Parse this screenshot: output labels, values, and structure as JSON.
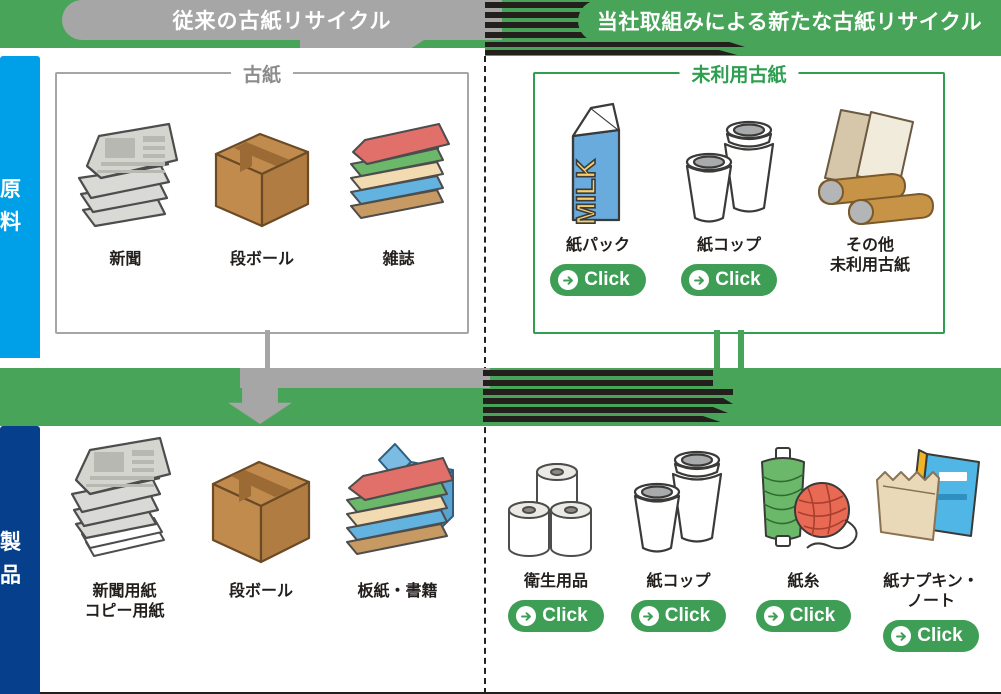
{
  "header": {
    "left_banner": "従来の古紙リサイクル",
    "right_banner": "当社取組みによる新たな古紙リサイクル",
    "left_bg": "#a6a6a6",
    "right_bg": "#47a458"
  },
  "sidebar": {
    "top_label": "原 料",
    "top_color": "#00a0e9",
    "bottom_label": "製 品",
    "bottom_color": "#063f8c"
  },
  "panels": {
    "materials_left": {
      "legend": "古紙",
      "border_color": "#a6a6a6",
      "items": [
        {
          "caption": "新聞",
          "icon": "newspaper-stack-icon"
        },
        {
          "caption": "段ボール",
          "icon": "cardboard-box-icon"
        },
        {
          "caption": "雑誌",
          "icon": "magazine-stack-icon"
        }
      ]
    },
    "materials_right": {
      "legend": "未利用古紙",
      "border_color": "#2e9e4f",
      "items": [
        {
          "caption": "紙パック",
          "icon": "milk-carton-icon",
          "button": "Click"
        },
        {
          "caption": "紙コップ",
          "icon": "paper-cups-icon",
          "button": "Click"
        },
        {
          "caption": "その他\n未利用古紙",
          "icon": "paper-sheets-tubes-icon",
          "button": null
        }
      ]
    },
    "products_left": {
      "items": [
        {
          "caption": "新聞用紙\nコピー用紙",
          "icon": "newsprint-copypaper-icon"
        },
        {
          "caption": "段ボール",
          "icon": "cardboard-box-icon"
        },
        {
          "caption": "板紙・書籍",
          "icon": "paperboard-books-icon"
        }
      ]
    },
    "products_right": {
      "items": [
        {
          "caption": "衛生用品",
          "icon": "toilet-rolls-icon",
          "button": "Click"
        },
        {
          "caption": "紙コップ",
          "icon": "paper-cups-icon",
          "button": "Click"
        },
        {
          "caption": "紙糸",
          "icon": "paper-yarn-icon",
          "button": "Click"
        },
        {
          "caption": "紙ナプキン・\nノート",
          "icon": "napkin-notebook-icon",
          "button": "Click"
        }
      ]
    }
  },
  "flow": {
    "left_arrow_color": "#a6a6a6",
    "right_arrow_color": "#231f1d",
    "band_color": "#47a458"
  },
  "milk_carton_text": "MILK"
}
